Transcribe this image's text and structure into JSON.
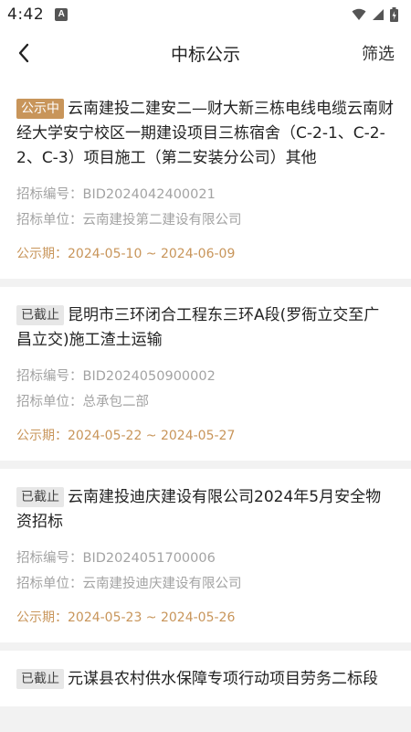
{
  "status_bar": {
    "time": "4:42",
    "a_icon": "A"
  },
  "header": {
    "title": "中标公示",
    "filter_label": "筛选"
  },
  "labels": {
    "bid_no": "招标编号：",
    "bid_unit": "招标单位：",
    "period": "公示期："
  },
  "items": [
    {
      "status": "公示中",
      "status_type": "active",
      "title": "云南建投二建安二—财大新三栋电线电缆云南财经大学安宁校区一期建设项目三栋宿舍（C-2-1、C-2-2、C-3）项目施工（第二安装分公司）其他",
      "bid_no": "BID2024042400021",
      "bid_unit": "云南建投第二建设有限公司",
      "period": "2024-05-10 ~ 2024-06-09"
    },
    {
      "status": "已截止",
      "status_type": "closed",
      "title": "昆明市三环闭合工程东三环A段(罗衙立交至广昌立交)施工渣土运输",
      "bid_no": "BID2024050900002",
      "bid_unit": "总承包二部",
      "period": "2024-05-22 ~ 2024-05-27"
    },
    {
      "status": "已截止",
      "status_type": "closed",
      "title": "云南建投迪庆建设有限公司2024年5月安全物资招标",
      "bid_no": "BID2024051700006",
      "bid_unit": "云南建投迪庆建设有限公司",
      "period": "2024-05-23 ~ 2024-05-26"
    },
    {
      "status": "已截止",
      "status_type": "closed",
      "title": "元谋县农村供水保障专项行动项目劳务二标段",
      "bid_no": "",
      "bid_unit": "",
      "period": ""
    }
  ]
}
